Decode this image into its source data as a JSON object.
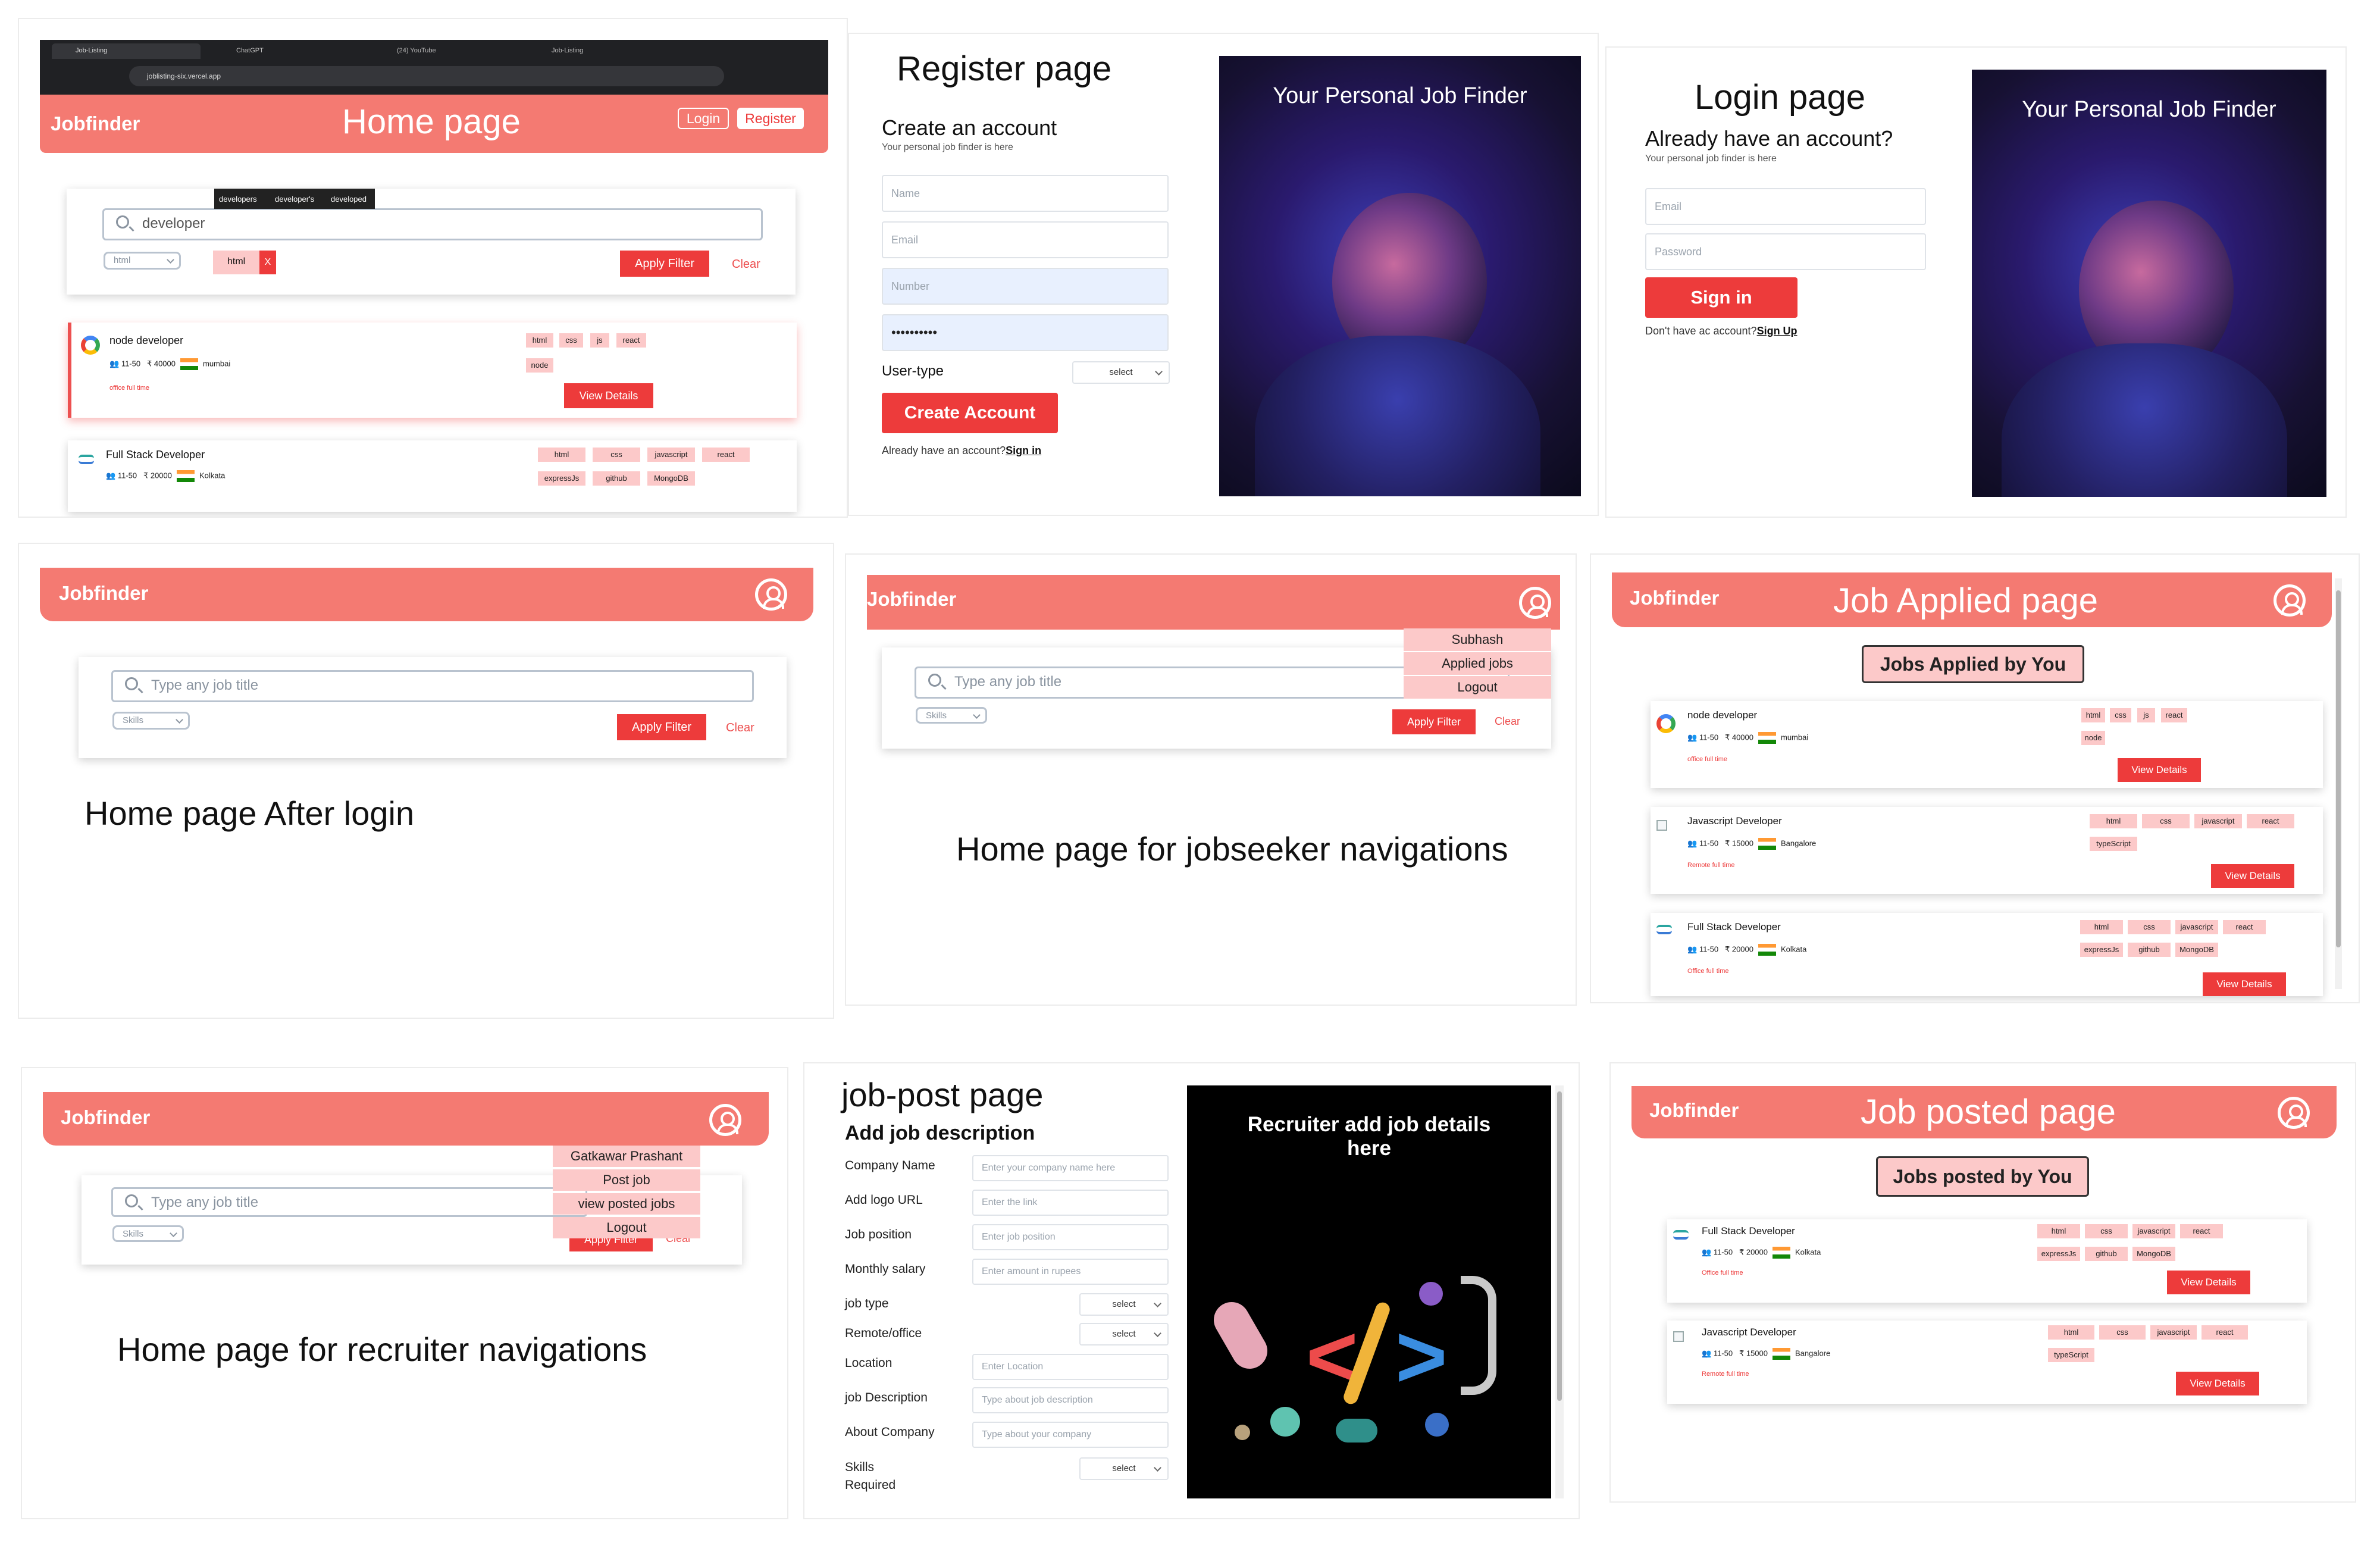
{
  "home": {
    "browser_tabs": [
      "Job-Listing",
      "ChatGPT",
      "(24) YouTube",
      "Job-Listing"
    ],
    "url": "joblisting-six.vercel.app",
    "brand": "Jobfinder",
    "title": "Home page",
    "login": "Login",
    "register": "Register",
    "search_value": "developer",
    "suggestions": [
      "developers",
      "developer's",
      "developed"
    ],
    "skills_value": "html",
    "chip": "html",
    "chip_remove": "X",
    "apply": "Apply Filter",
    "clear": "Clear",
    "jobs": [
      {
        "title": "node developer",
        "size": "11-50",
        "salary": "₹ 40000",
        "city": "mumbai",
        "tags": "office  full time",
        "skills": [
          "html",
          "css",
          "js",
          "react",
          "node"
        ],
        "view": "View Details"
      },
      {
        "title": "Full Stack Developer",
        "size": "11-50",
        "salary": "₹ 20000",
        "city": "Kolkata",
        "skills": [
          "html",
          "css",
          "javascript",
          "react",
          "expressJs",
          "github",
          "MongoDB"
        ]
      }
    ]
  },
  "register": {
    "title": "Register page",
    "heading": "Create an account",
    "sub": "Your personal job finder is here",
    "name_ph": "Name",
    "email_ph": "Email",
    "number_ph": "Number",
    "password_val": "••••••••••",
    "usertype_label": "User-type",
    "select": "select",
    "create": "Create Account",
    "already": "Already have an account?",
    "signin_link": "Sign in",
    "hero": "Your Personal Job Finder"
  },
  "login": {
    "title": "Login page",
    "heading": "Already have an account?",
    "sub": "Your personal job finder is here",
    "email_ph": "Email",
    "password_ph": "Password",
    "signin": "Sign in",
    "noacc": "Don't have ac account?",
    "signup_link": "Sign Up",
    "hero": "Your Personal Job Finder"
  },
  "after_login": {
    "brand": "Jobfinder",
    "search_ph": "Type any job title",
    "skills": "Skills",
    "apply": "Apply Filter",
    "clear": "Clear",
    "caption": "Home page After login"
  },
  "jobseeker_nav": {
    "brand": "Jobfinder",
    "search_ph": "Type any job title",
    "skills": "Skills",
    "apply": "Apply Filter",
    "clear": "Clear",
    "menu": [
      "Subhash",
      "Applied jobs",
      "Logout"
    ],
    "caption": "Home page for jobseeker navigations"
  },
  "applied": {
    "brand": "Jobfinder",
    "title": "Job Applied page",
    "badge": "Jobs Applied by You",
    "jobs": [
      {
        "title": "node developer",
        "size": "11-50",
        "salary": "₹ 40000",
        "city": "mumbai",
        "tags": "office  full time",
        "skills": [
          "html",
          "css",
          "js",
          "react",
          "node"
        ],
        "view": "View Details"
      },
      {
        "title": "Javascript Developer",
        "size": "11-50",
        "salary": "₹ 15000",
        "city": "Bangalore",
        "tags": "Remote  full time",
        "skills": [
          "html",
          "css",
          "javascript",
          "react",
          "typeScript"
        ],
        "view": "View Details"
      },
      {
        "title": "Full Stack Developer",
        "size": "11-50",
        "salary": "₹ 20000",
        "city": "Kolkata",
        "tags": "Office  full time",
        "skills": [
          "html",
          "css",
          "javascript",
          "react",
          "expressJs",
          "github",
          "MongoDB"
        ],
        "view": "View Details"
      }
    ]
  },
  "recruiter_nav": {
    "brand": "Jobfinder",
    "search_ph": "Type any job title",
    "skills": "Skills",
    "apply": "Apply Filter",
    "clear": "Clear",
    "menu": [
      "Gatkawar Prashant",
      "Post job",
      "view posted jobs",
      "Logout"
    ],
    "caption": "Home page for recruiter navigations"
  },
  "jobpost": {
    "title": "job-post page",
    "heading": "Add job description",
    "fields": [
      {
        "label": "Company Name",
        "ph": "Enter your company name here"
      },
      {
        "label": "Add logo URL",
        "ph": "Enter the link"
      },
      {
        "label": "Job position",
        "ph": "Enter job position"
      },
      {
        "label": "Monthly salary",
        "ph": "Enter amount in rupees"
      },
      {
        "label": "job type",
        "ph": "select"
      },
      {
        "label": "Remote/office",
        "ph": "select"
      },
      {
        "label": "Location",
        "ph": "Enter Location"
      },
      {
        "label": "job Description",
        "ph": "Type about job description"
      },
      {
        "label": "About Company",
        "ph": "Type about your company"
      },
      {
        "label": "Skills Required",
        "ph": "select"
      }
    ],
    "hero": "Recruiter add job details here"
  },
  "posted": {
    "brand": "Jobfinder",
    "title": "Job posted page",
    "badge": "Jobs posted by You",
    "jobs": [
      {
        "title": "Full Stack Developer",
        "size": "11-50",
        "salary": "₹ 20000",
        "city": "Kolkata",
        "tags": "Office  full time",
        "skills": [
          "html",
          "css",
          "javascript",
          "react",
          "expressJs",
          "github",
          "MongoDB"
        ],
        "view": "View Details"
      },
      {
        "title": "Javascript Developer",
        "size": "11-50",
        "salary": "₹ 15000",
        "city": "Bangalore",
        "tags": "Remote  full time",
        "skills": [
          "html",
          "css",
          "javascript",
          "react",
          "typeScript"
        ],
        "view": "View Details"
      }
    ]
  },
  "colors": {
    "accent": "#f47a72",
    "button": "#ed3b3b",
    "tag": "#fcc9c9"
  }
}
